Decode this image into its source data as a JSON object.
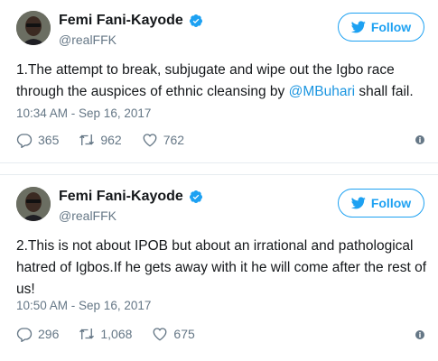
{
  "tweets": [
    {
      "display_name": "Femi Fani-Kayode",
      "handle": "@realFFK",
      "follow_label": "Follow",
      "text_before": "1.The attempt to break, subjugate and wipe out the Igbo race through the auspices of ethnic cleansing by ",
      "mention": "@MBuhari",
      "text_after": " shall fail.",
      "timestamp": "10:34 AM - Sep 16, 2017",
      "replies": "365",
      "retweets": "962",
      "likes": "762"
    },
    {
      "display_name": "Femi Fani-Kayode",
      "handle": "@realFFK",
      "follow_label": "Follow",
      "text": "2.This is not about IPOB but about an irrational and pathological hatred of Igbos.If he gets away with it he will come after the rest of us!",
      "timestamp": "10:50 AM - Sep 16, 2017",
      "replies": "296",
      "retweets": "1,068",
      "likes": "675"
    }
  ],
  "colors": {
    "accent": "#1da1f2",
    "mention": "#1b95e0",
    "muted": "#657786",
    "text": "#14171a"
  },
  "icons": [
    "verified-badge-icon",
    "twitter-bird-icon",
    "reply-icon",
    "retweet-icon",
    "like-icon",
    "info-icon"
  ]
}
